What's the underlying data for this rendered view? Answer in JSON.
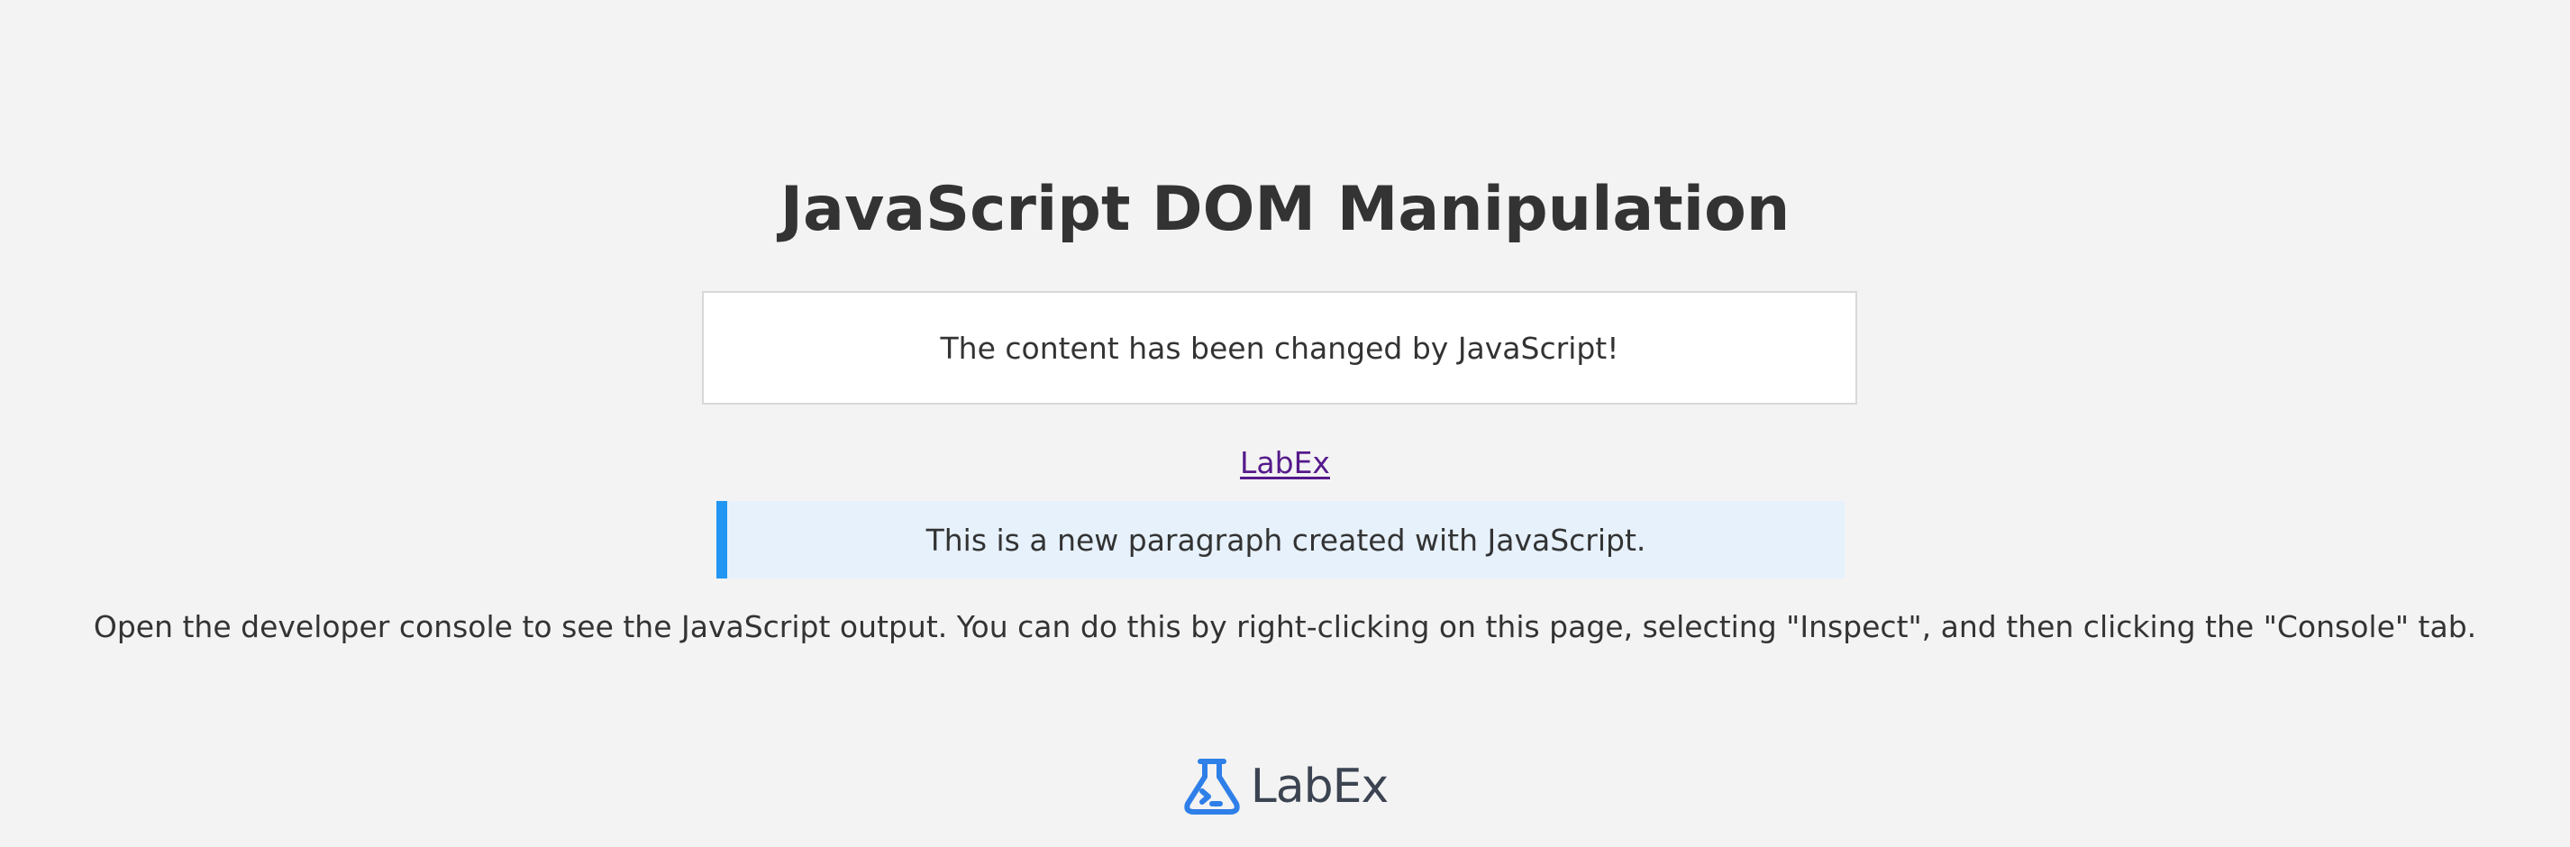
{
  "page": {
    "title": "JavaScript DOM Manipulation"
  },
  "content_box": {
    "text": "The content has been changed by JavaScript!"
  },
  "link": {
    "text": "LabEx"
  },
  "new_paragraph": {
    "text": "This is a new paragraph created with JavaScript."
  },
  "console_note": {
    "text": "Open the developer console to see the JavaScript output. You can do this by right-clicking on this page, selecting \"Inspect\", and then clicking the \"Console\" tab."
  },
  "footer": {
    "logo_icon": "flask-terminal-icon",
    "logo_text": "LabEx"
  },
  "colors": {
    "background": "#f3f3f3",
    "text": "#333333",
    "link_visited": "#551a8b",
    "accent_border": "#2196f3",
    "highlight_bg": "#e6f1fc",
    "logo_icon": "#2e7fe8",
    "logo_text": "#3c4452"
  }
}
